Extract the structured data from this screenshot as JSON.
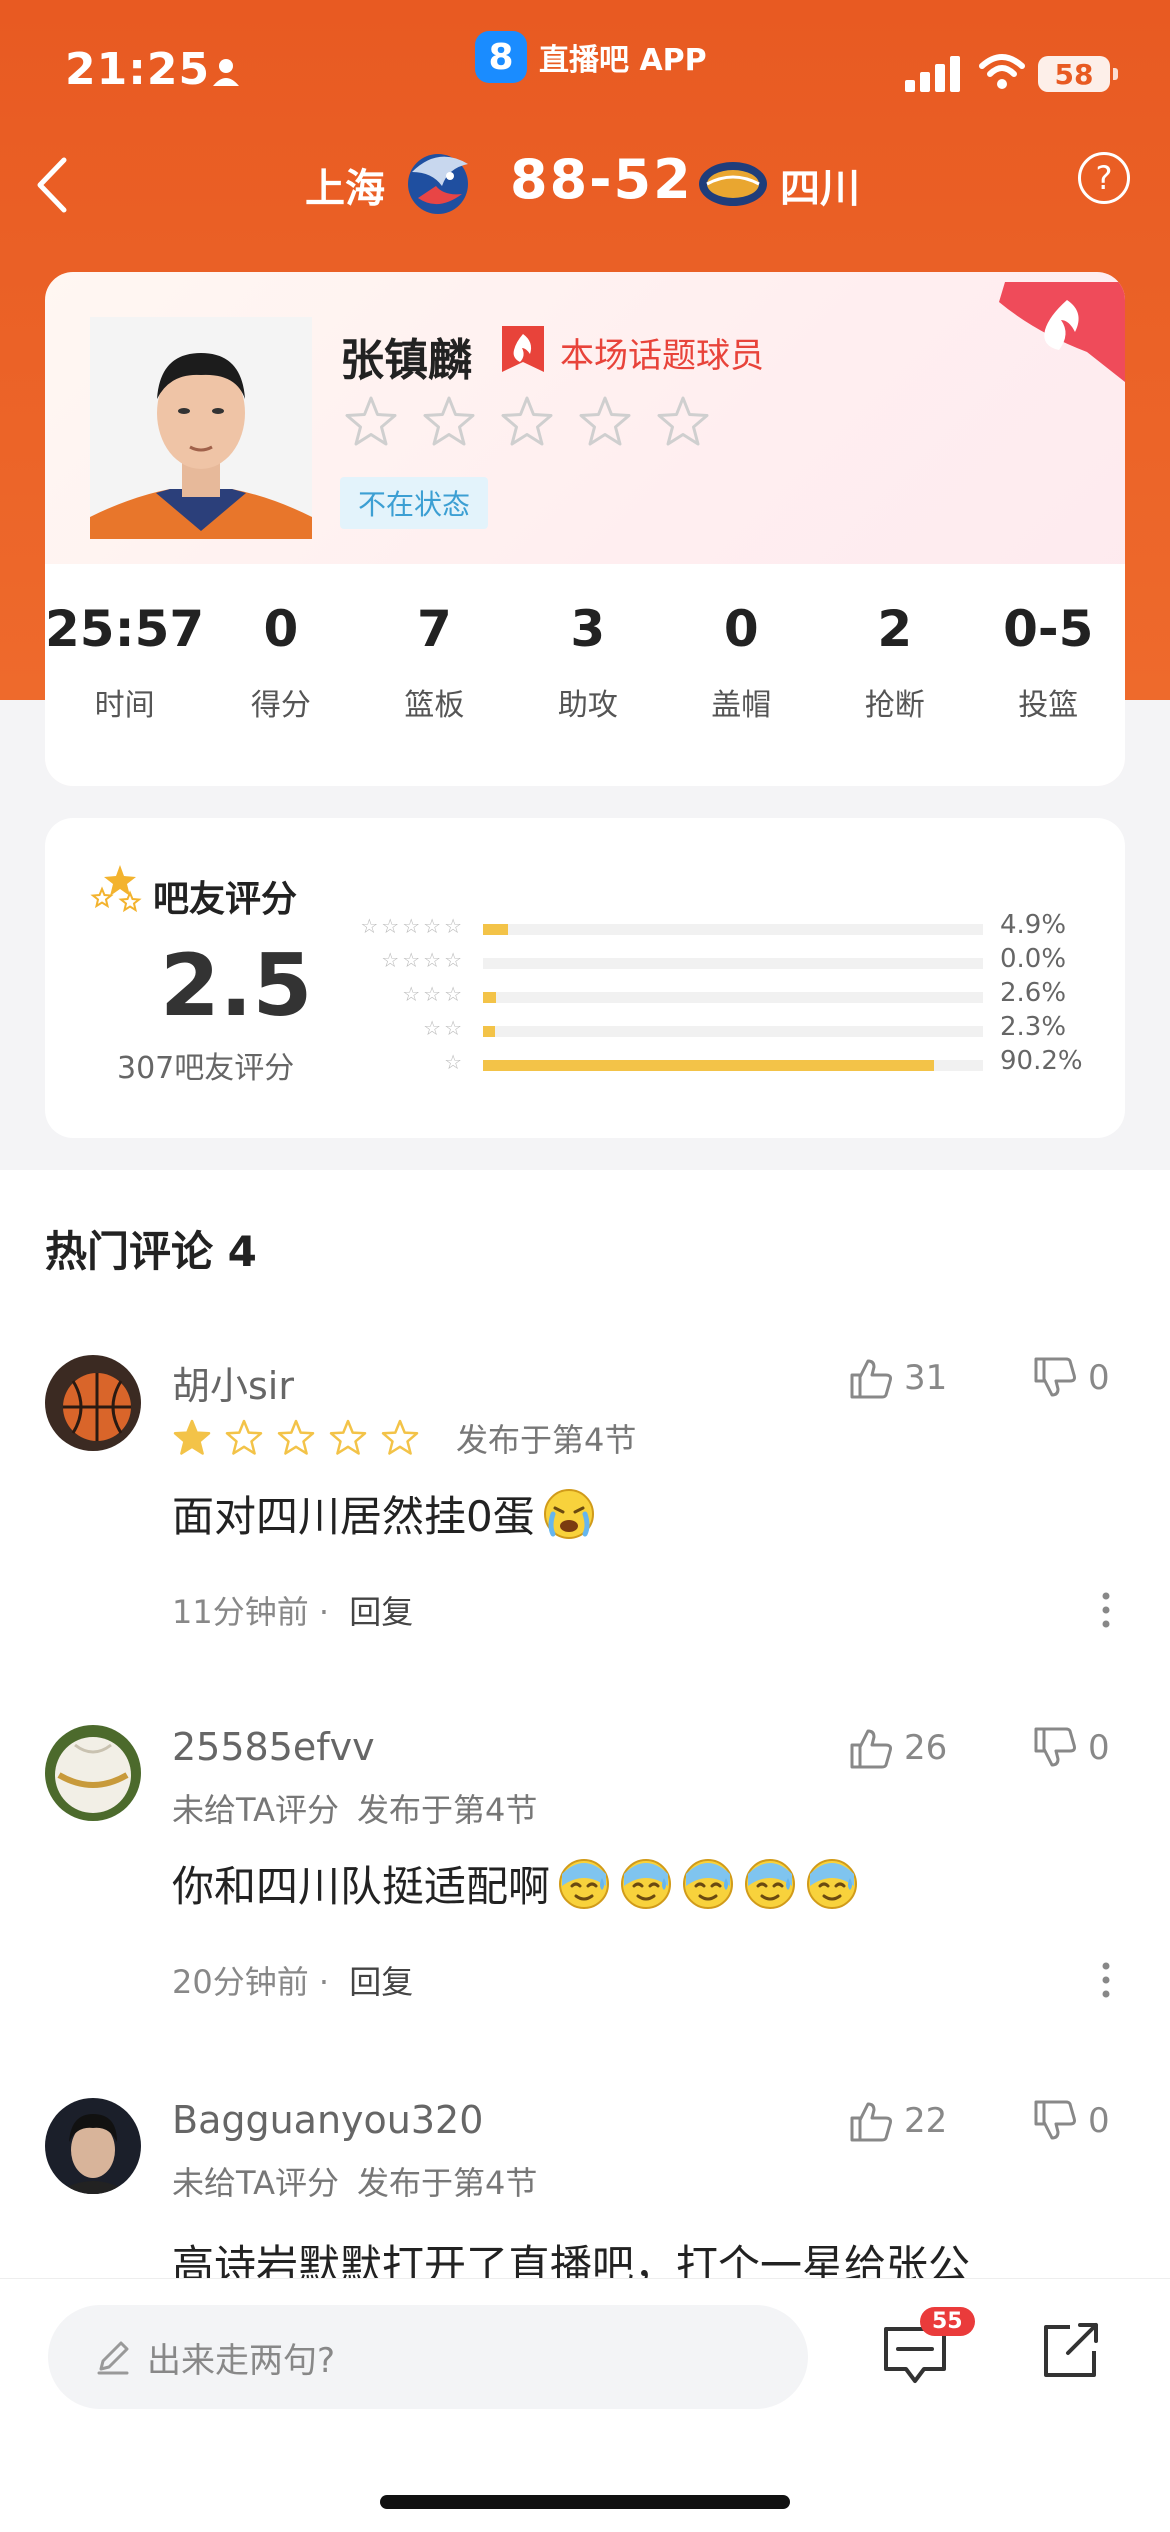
{
  "status_bar": {
    "time": "21:25",
    "app_name": "直播吧 APP",
    "app_logo_text": "8",
    "battery": "58"
  },
  "game": {
    "home_team": "上海",
    "away_team": "四川",
    "score": "88-52"
  },
  "player": {
    "name": "张镇麟",
    "hot_label": "本场话题球员",
    "state_tag": "不在状态",
    "stats": [
      {
        "value": "25:57",
        "label": "时间"
      },
      {
        "value": "0",
        "label": "得分"
      },
      {
        "value": "7",
        "label": "篮板"
      },
      {
        "value": "3",
        "label": "助攻"
      },
      {
        "value": "0",
        "label": "盖帽"
      },
      {
        "value": "2",
        "label": "抢断"
      },
      {
        "value": "0-5",
        "label": "投篮"
      }
    ]
  },
  "fan_rating": {
    "title": "吧友评分",
    "score": "2.5",
    "count_text": "307吧友评分",
    "distribution": [
      {
        "stars": 5,
        "percent": 4.9,
        "label": "4.9%"
      },
      {
        "stars": 4,
        "percent": 0.0,
        "label": "0.0%"
      },
      {
        "stars": 3,
        "percent": 2.6,
        "label": "2.6%"
      },
      {
        "stars": 2,
        "percent": 2.3,
        "label": "2.3%"
      },
      {
        "stars": 1,
        "percent": 90.2,
        "label": "90.2%"
      }
    ]
  },
  "comments": {
    "title": "热门评论 4",
    "items": [
      {
        "user": "胡小sir",
        "rating": 1,
        "rating_text": "",
        "section": "发布于第4节",
        "text": "面对四川居然挂0蛋",
        "emoji": "crying-face",
        "time": "11分钟前",
        "reply": "回复",
        "likes": "31",
        "dislikes": "0"
      },
      {
        "user": "25585efvv",
        "rating": 0,
        "rating_text": "未给TA评分",
        "section": "发布于第4节",
        "text": "你和四川队挺适配啊",
        "emoji": "sweat-face",
        "time": "20分钟前",
        "reply": "回复",
        "likes": "26",
        "dislikes": "0"
      },
      {
        "user": "Bagguanyou320",
        "rating": 0,
        "rating_text": "未给TA评分",
        "section": "发布于第4节",
        "text": "高诗岩默默打开了直播吧，打个一星给张公",
        "likes": "22",
        "dislikes": "0"
      }
    ]
  },
  "bottom_bar": {
    "input_placeholder": "出来走两句?",
    "comment_badge": "55"
  },
  "colors": {
    "accent": "#E85A22",
    "star": "#F3C348",
    "hot": "#E8433A",
    "tag": "#3C9FD3"
  }
}
